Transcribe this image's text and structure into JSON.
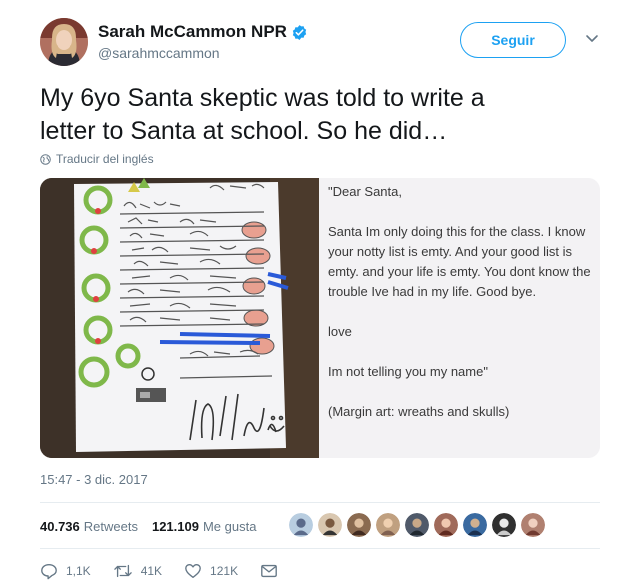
{
  "author": {
    "display_name": "Sarah McCammon NPR",
    "handle": "@sarahmccammon",
    "verified": true,
    "avatar_icon": "user-avatar"
  },
  "follow_label": "Seguir",
  "tweet": {
    "text_line1": "My 6yo Santa skeptic was told to write a",
    "text_line2": "letter to Santa at school. So he did…"
  },
  "translate_label": "Traducir del inglés",
  "media": {
    "transcript": [
      "\"Dear Santa,",
      "Santa Im only doing this for the class. I know your notty list is emty. And your good list is emty. and your life is emty. You dont know the trouble Ive had in my life. Good bye.",
      "love",
      "Im not telling you my name\"",
      "(Margin art: wreaths and skulls)"
    ]
  },
  "timestamp": "15:47 - 3 dic. 2017",
  "stats": {
    "retweets_count": "40.736",
    "retweets_label": "Retweets",
    "likes_count": "121.109",
    "likes_label": "Me gusta"
  },
  "actions": {
    "replies": "1,1K",
    "retweets": "41K",
    "likes": "121K"
  },
  "colors": {
    "accent": "#1da1f2",
    "muted": "#657786",
    "text": "#14171a"
  }
}
